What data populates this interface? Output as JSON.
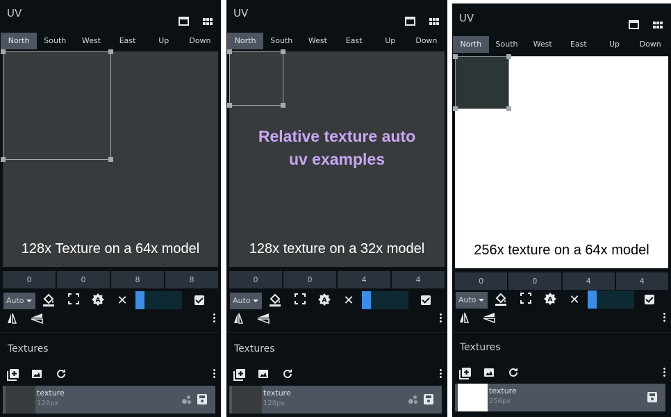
{
  "panels": [
    {
      "title": "UV",
      "tabs": [
        "North",
        "South",
        "West",
        "East",
        "Up",
        "Down"
      ],
      "active_tab": "North",
      "caption": "128x Texture on a 64x model",
      "overlay": "",
      "uv_values": [
        "0",
        "0",
        "8",
        "8"
      ],
      "auto_label": "Auto",
      "texture_section_title": "Textures",
      "texture": {
        "name": "texture",
        "size": "128px"
      }
    },
    {
      "title": "UV",
      "tabs": [
        "North",
        "South",
        "West",
        "East",
        "Up",
        "Down"
      ],
      "active_tab": "North",
      "caption": "128x texture on a 32x model",
      "overlay": "Relative texture auto uv examples",
      "uv_values": [
        "0",
        "0",
        "4",
        "4"
      ],
      "auto_label": "Auto",
      "texture_section_title": "Textures",
      "texture": {
        "name": "texture",
        "size": "128px"
      }
    },
    {
      "title": "UV",
      "tabs": [
        "North",
        "South",
        "West",
        "East",
        "Up",
        "Down"
      ],
      "active_tab": "North",
      "caption": "256x texture on a 64x model",
      "overlay": "",
      "uv_values": [
        "0",
        "0",
        "4",
        "4"
      ],
      "auto_label": "Auto",
      "texture_section_title": "Textures",
      "texture": {
        "name": "texture",
        "size": "256px"
      }
    }
  ],
  "icons": {
    "window": "window-icon",
    "grid": "grid-icon",
    "paint_bucket": "paint-bucket-icon",
    "maximize": "maximize-icon",
    "auto_uv": "auto-uv-icon",
    "clear": "close-icon",
    "checkbox": "checkbox-icon",
    "mirror_x": "mirror-x-icon",
    "mirror_y": "mirror-y-icon",
    "more": "more-vertical-icon",
    "add_texture": "add-texture-icon",
    "import_texture": "image-icon",
    "reload": "reload-icon",
    "save": "save-icon"
  },
  "colors": {
    "panel_bg": "#0b1015",
    "tab_active": "#4c5560",
    "canvas_gray": "#373b3d",
    "slider_accent": "#3d8de6",
    "overlay_text": "#c9a6f2"
  },
  "slider_fill_fraction": 0.2
}
